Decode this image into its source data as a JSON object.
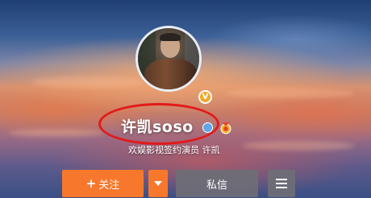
{
  "profile": {
    "name": "许凯soso",
    "subtitle": "欢娱影视签约演员 许凯",
    "verified_badge": "V",
    "icons": [
      "avatar",
      "verified-v-icon",
      "male-gender-icon",
      "medal-icon"
    ]
  },
  "actions": {
    "follow_plus": "+",
    "follow_label": "关注",
    "message_label": "私信",
    "more_icon": "chevron-down-icon",
    "menu_icon": "hamburger-menu-icon"
  },
  "colors": {
    "accent": "#f7782c",
    "secondary_button": "#6e6e76",
    "annotation_circle": "#e21a1a",
    "verified_badge": "#f6a623"
  }
}
